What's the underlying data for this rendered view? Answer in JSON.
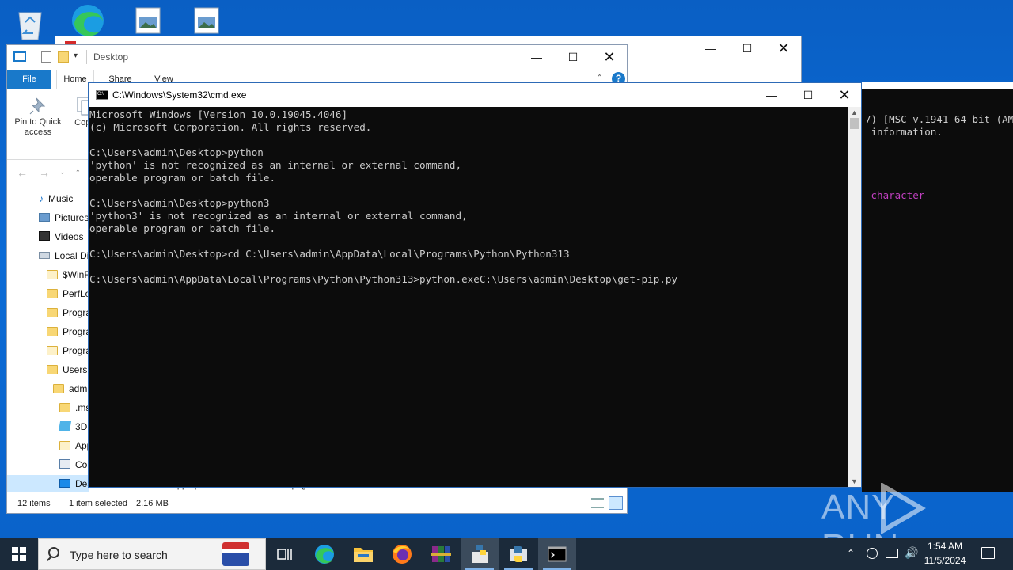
{
  "desktop": {
    "watermark": "ANY RUN"
  },
  "explorer": {
    "title": "Desktop",
    "tabs": [
      "File",
      "Home",
      "Share",
      "View"
    ],
    "ribbon": {
      "pin_label": "Pin to Quick access",
      "copy_label": "Copy"
    },
    "tree": [
      {
        "label": "Music",
        "icon": "music-icon"
      },
      {
        "label": "Pictures",
        "icon": "pictures-icon"
      },
      {
        "label": "Videos",
        "icon": "videos-icon"
      },
      {
        "label": "Local Di",
        "icon": "drive-icon"
      },
      {
        "label": "$WinR",
        "icon": "folder-icon"
      },
      {
        "label": "PerfLo",
        "icon": "folder-icon"
      },
      {
        "label": "Progra",
        "icon": "folder-icon"
      },
      {
        "label": "Progra",
        "icon": "folder-icon"
      },
      {
        "label": "Progra",
        "icon": "folder-icon"
      },
      {
        "label": "Users",
        "icon": "folder-icon"
      },
      {
        "label": "admi",
        "icon": "folder-icon"
      },
      {
        "label": ".ms",
        "icon": "folder-icon"
      },
      {
        "label": "3D",
        "icon": "3d-objects-icon"
      },
      {
        "label": "App",
        "icon": "folder-icon"
      },
      {
        "label": "Cor",
        "icon": "contacts-icon"
      },
      {
        "label": "Des",
        "icon": "desktop-icon"
      }
    ],
    "file_fragments": [
      "wasteappropriate",
      "wasterules.png"
    ],
    "status": {
      "items": "12 items",
      "selected": "1 item selected",
      "size": "2.16 MB"
    }
  },
  "python_console": {
    "lines": [
      "7) [MSC v.1941 64 bit (AM",
      " information.",
      "",
      "",
      "",
      "",
      " character"
    ]
  },
  "cmd": {
    "title": "C:\\Windows\\System32\\cmd.exe",
    "lines": [
      "Microsoft Windows [Version 10.0.19045.4046]",
      "(c) Microsoft Corporation. All rights reserved.",
      "",
      "C:\\Users\\admin\\Desktop>python",
      "'python' is not recognized as an internal or external command,",
      "operable program or batch file.",
      "",
      "C:\\Users\\admin\\Desktop>python3",
      "'python3' is not recognized as an internal or external command,",
      "operable program or batch file.",
      "",
      "C:\\Users\\admin\\Desktop>cd C:\\Users\\admin\\AppData\\Local\\Programs\\Python\\Python313",
      "",
      "C:\\Users\\admin\\AppData\\Local\\Programs\\Python\\Python313>python.exeC:\\Users\\admin\\Desktop\\get-pip.py"
    ]
  },
  "taskbar": {
    "search_placeholder": "Type here to search",
    "time": "1:54 AM",
    "date": "11/5/2024"
  },
  "colors": {
    "desktop_blue": "#0a62c9",
    "file_tab": "#1979ca",
    "taskbar": "#1b2a3a",
    "console_bg": "#0c0c0c",
    "console_text": "#cccccc",
    "magenta_text": "#c040c0"
  }
}
